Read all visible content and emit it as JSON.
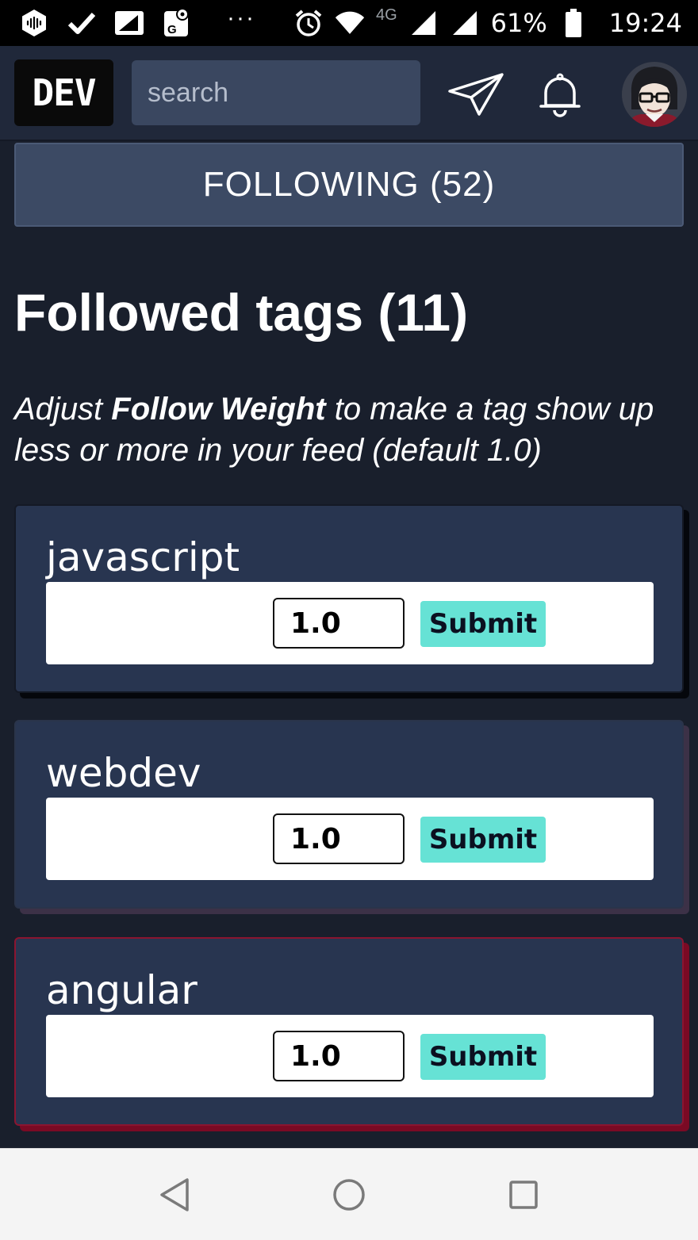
{
  "status_bar": {
    "network": "4G",
    "battery": "61%",
    "time": "19:24",
    "overflow": "···"
  },
  "header": {
    "logo": "DEV",
    "search_placeholder": "search"
  },
  "following_button": "FOLLOWING (52)",
  "page_title": "Followed tags (11)",
  "subtitle": {
    "prefix": "Adjust ",
    "emphasis": "Follow Weight",
    "suffix": " to make a tag show up less or more in your feed (default 1.0)"
  },
  "tags": [
    {
      "name": "javascript",
      "weight": "1.0",
      "submit": "Submit",
      "accent": "#05070c"
    },
    {
      "name": "webdev",
      "weight": "1.0",
      "submit": "Submit",
      "accent": "#3c3147"
    },
    {
      "name": "angular",
      "weight": "1.0",
      "submit": "Submit",
      "accent": "#7a0a24"
    }
  ],
  "colors": {
    "background": "#191f2c",
    "header": "#20283a",
    "card": "#283550",
    "submit": "#66e2d5"
  },
  "icons": {
    "status_left": [
      "podcast-icon",
      "check-icon",
      "note-icon",
      "maps-icon"
    ],
    "status_right": [
      "alarm-icon",
      "wifi-icon",
      "signal-icon",
      "battery-icon"
    ],
    "header": [
      "send-icon",
      "bell-icon"
    ],
    "nav": [
      "back-icon",
      "home-icon",
      "recents-icon"
    ]
  }
}
